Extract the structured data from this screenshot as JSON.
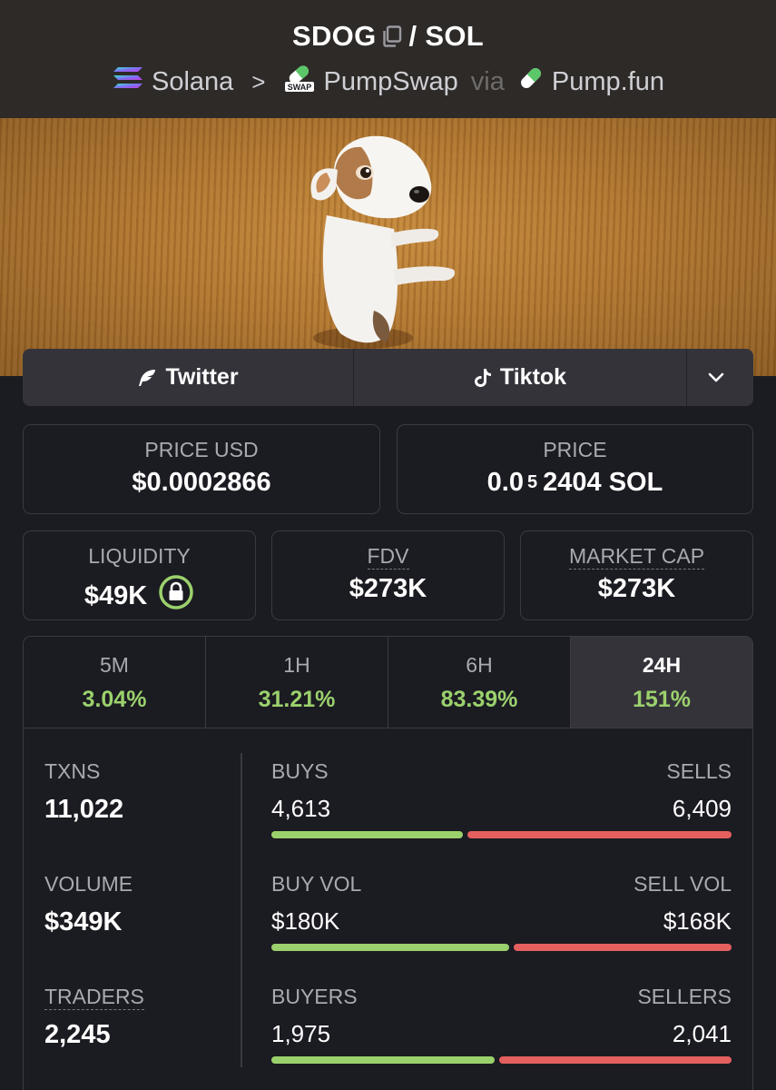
{
  "header": {
    "base": "SDOG",
    "quote": "/ SOL",
    "chain": "Solana",
    "chain_sep": ">",
    "dex": "PumpSwap",
    "via": "via",
    "launchpad": "Pump.fun",
    "dex_badge": "SWAP"
  },
  "social": {
    "twitter": "Twitter",
    "tiktok": "Tiktok"
  },
  "stats": {
    "price_usd_label": "PRICE USD",
    "price_usd": "$0.0002866",
    "price_label": "PRICE",
    "price_prefix": "0.0",
    "price_zeros": "5",
    "price_suffix": "2404 SOL",
    "liquidity_label": "LIQUIDITY",
    "liquidity": "$49K",
    "fdv_label": "FDV",
    "fdv": "$273K",
    "mcap_label": "MARKET CAP",
    "mcap": "$273K"
  },
  "timeframes": [
    {
      "label": "5M",
      "change": "3.04%"
    },
    {
      "label": "1H",
      "change": "31.21%"
    },
    {
      "label": "6H",
      "change": "83.39%"
    },
    {
      "label": "24H",
      "change": "151%"
    }
  ],
  "txns": {
    "txns_label": "TXNS",
    "txns": "11,022",
    "volume_label": "VOLUME",
    "volume": "$349K",
    "traders_label": "TRADERS",
    "traders": "2,245",
    "buys_label": "BUYS",
    "buys": "4,613",
    "sells_label": "SELLS",
    "sells": "6,409",
    "buys_fraction": 0.42,
    "buyvol_label": "BUY VOL",
    "buyvol": "$180K",
    "sellvol_label": "SELL VOL",
    "sellvol": "$168K",
    "buyvol_fraction": 0.52,
    "buyers_label": "BUYERS",
    "buyers": "1,975",
    "sellers_label": "SELLERS",
    "sellers": "2,041",
    "buyers_fraction": 0.49
  },
  "colors": {
    "positive": "#9bd16c",
    "negative": "#e4605e",
    "background": "#1b1b22",
    "header": "#2d2a28"
  }
}
